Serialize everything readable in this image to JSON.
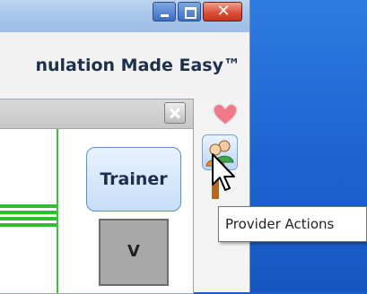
{
  "window": {
    "title_text": "nulation Made Easy™",
    "controls": {
      "minimize": "minimize",
      "maximize": "maximize",
      "close": "✕"
    }
  },
  "panel": {
    "trainer_label": "Trainer",
    "v_label": "V"
  },
  "tooltip": {
    "text": "Provider Actions"
  },
  "icons": [
    "heart-icon",
    "provider-actions-icon",
    "mouse-cursor-icon",
    "close-icon"
  ],
  "colors": {
    "desktop": "#1d63cf",
    "close_button": "#d9533a",
    "green_lines": "#2fbf2f",
    "trainer_button": "#c7ddf7"
  }
}
